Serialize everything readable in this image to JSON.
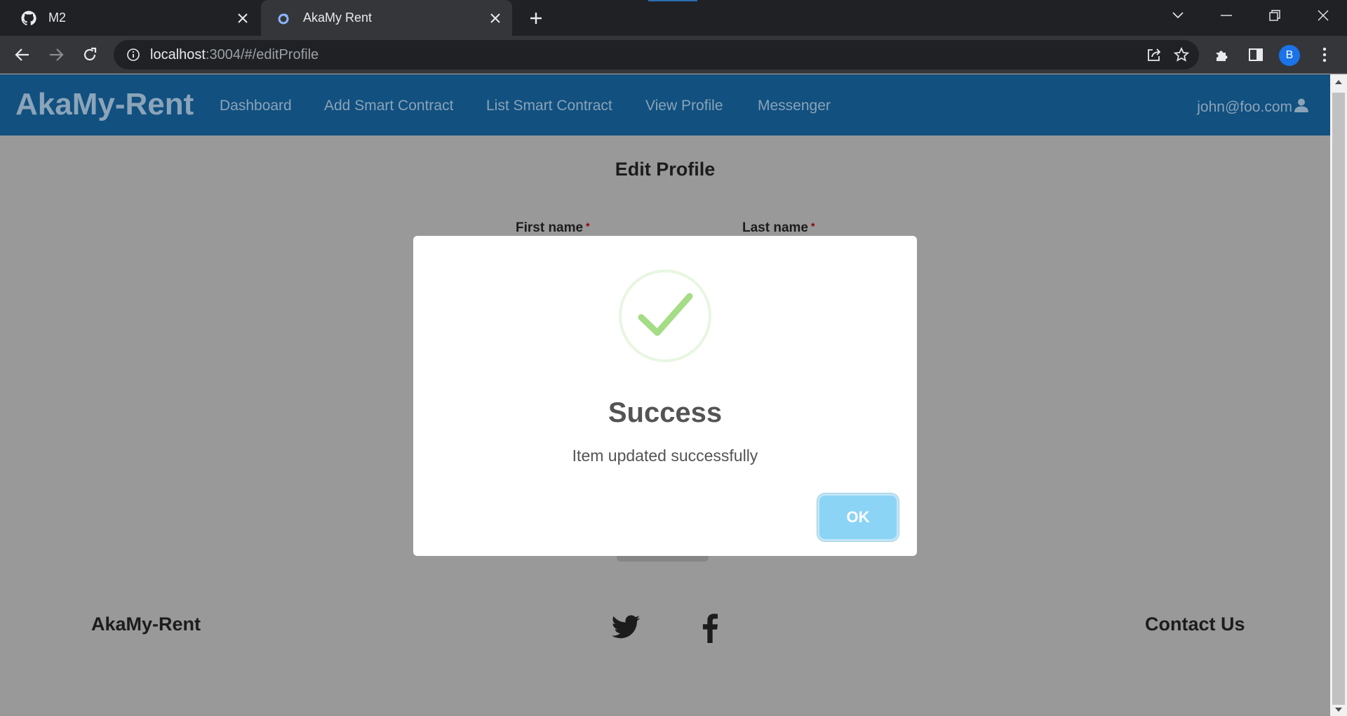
{
  "browser": {
    "tabs": [
      {
        "title": "M2",
        "icon": "github-icon"
      },
      {
        "title": "AkaMy Rent",
        "icon": "site-favicon"
      }
    ],
    "url_host": "localhost",
    "url_rest": ":3004/#/editProfile",
    "profile_initial": "B"
  },
  "navbar": {
    "brand": "AkaMy-Rent",
    "links": [
      "Dashboard",
      "Add Smart Contract",
      "List Smart Contract",
      "View Profile",
      "Messenger"
    ],
    "user": "john@foo.com"
  },
  "form": {
    "title": "Edit Profile",
    "first_name_label": "First name",
    "last_name_label": "Last name",
    "required_mark": "*"
  },
  "modal": {
    "title": "Success",
    "text": "Item updated successfully",
    "ok_label": "OK",
    "icon": "success-check-icon",
    "check_color": "#a5dc86",
    "button_color": "#8cd4f5"
  },
  "footer": {
    "brand": "AkaMy-Rent",
    "contact": "Contact Us",
    "social_icons": [
      "twitter-icon",
      "facebook-icon"
    ]
  },
  "colors": {
    "navbar_bg": "#11507f",
    "overlay_bg": "#999999",
    "chrome_dark": "#202124"
  }
}
